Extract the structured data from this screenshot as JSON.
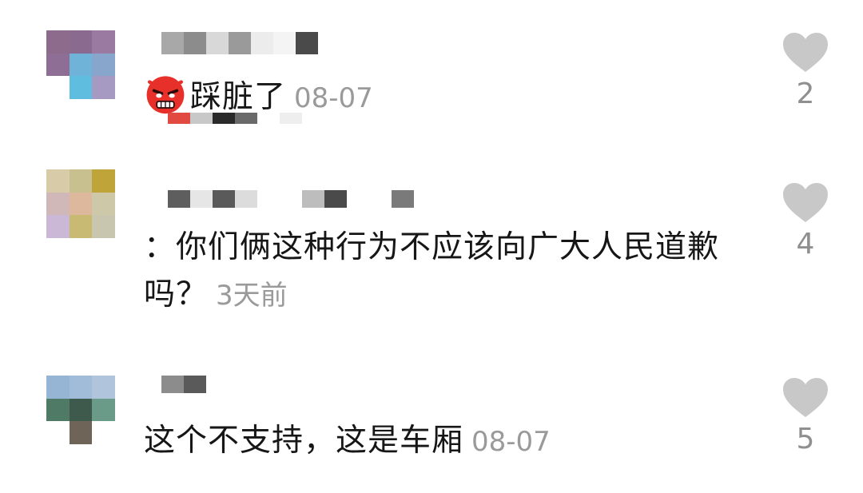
{
  "comments": [
    {
      "text": "踩脏了",
      "timestamp": "08-07",
      "like_count": "2",
      "emoji": "angry-face-icon"
    },
    {
      "text": "：你们俩这种行为不应该向广大人民道歉吗？",
      "timestamp": "3天前",
      "like_count": "4"
    },
    {
      "text": "这个不支持，这是车厢",
      "timestamp": "08-07",
      "like_count": "5"
    }
  ],
  "colors": {
    "text": "#161616",
    "timestamp": "#9a9a9a",
    "heart": "#c8c8c8",
    "like_count": "#8f8f8f",
    "emoji_red": "#e8302a"
  }
}
